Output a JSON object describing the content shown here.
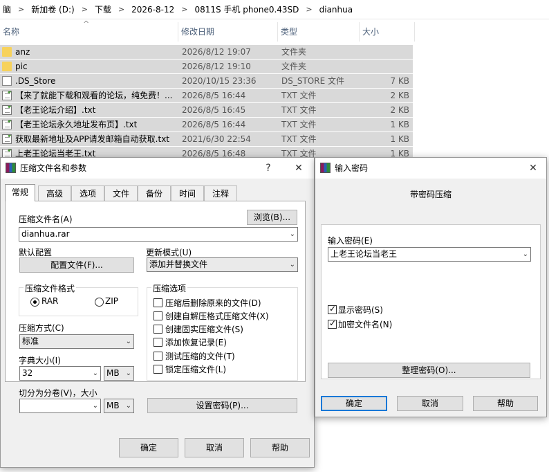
{
  "breadcrumb": [
    "脑",
    "新加卷 (D:)",
    "下载",
    "2026-8-12",
    "0811S 手机 phone0.43SD",
    "dianhua"
  ],
  "breadcrumb_sep": ">",
  "columns": {
    "name": "名称",
    "date": "修改日期",
    "type": "类型",
    "size": "大小"
  },
  "files": [
    {
      "icon": "folder-icon",
      "name": "anz",
      "date": "2026/8/12 19:07",
      "type": "文件夹",
      "size": ""
    },
    {
      "icon": "folder-icon",
      "name": "pic",
      "date": "2026/8/12 19:10",
      "type": "文件夹",
      "size": ""
    },
    {
      "icon": "file-icon",
      "name": ".DS_Store",
      "date": "2020/10/15 23:36",
      "type": "DS_STORE 文件",
      "size": "7 KB"
    },
    {
      "icon": "txt-icon",
      "name": "【来了就能下载和观看的论坛，纯免费！...",
      "date": "2026/8/5 16:44",
      "type": "TXT 文件",
      "size": "2 KB"
    },
    {
      "icon": "txt-icon",
      "name": "【老王论坛介绍】.txt",
      "date": "2026/8/5 16:45",
      "type": "TXT 文件",
      "size": "2 KB"
    },
    {
      "icon": "txt-icon",
      "name": "【老王论坛永久地址发布页】.txt",
      "date": "2026/8/5 16:44",
      "type": "TXT 文件",
      "size": "1 KB"
    },
    {
      "icon": "txt-icon",
      "name": "获取最新地址及APP请发邮箱自动获取.txt",
      "date": "2021/6/30 22:54",
      "type": "TXT 文件",
      "size": "1 KB"
    },
    {
      "icon": "txt-icon",
      "name": "上老王论坛当老王.txt",
      "date": "2026/8/5 16:48",
      "type": "TXT 文件",
      "size": "1 KB"
    }
  ],
  "archive_dialog": {
    "title": "压缩文件名和参数",
    "help_glyph": "?",
    "close_glyph": "✕",
    "tabs": [
      "常规",
      "高级",
      "选项",
      "文件",
      "备份",
      "时间",
      "注释"
    ],
    "archive_name_label": "压缩文件名(A)",
    "archive_name_value": "dianhua.rar",
    "browse_label": "浏览(B)...",
    "default_profile_label": "默认配置",
    "profile_button": "配置文件(F)...",
    "update_mode_label": "更新模式(U)",
    "update_mode_value": "添加并替换文件",
    "format_group": "压缩文件格式",
    "format_rar": "RAR",
    "format_zip": "ZIP",
    "options_group": "压缩选项",
    "options": [
      "压缩后删除原来的文件(D)",
      "创建自解压格式压缩文件(X)",
      "创建固实压缩文件(S)",
      "添加恢复记录(E)",
      "测试压缩的文件(T)",
      "锁定压缩文件(L)"
    ],
    "method_label": "压缩方式(C)",
    "method_value": "标准",
    "dict_label": "字典大小(I)",
    "dict_value": "32",
    "dict_unit": "MB",
    "split_label": "切分为分卷(V)，大小",
    "split_value": "",
    "split_unit": "MB",
    "set_password_button": "设置密码(P)...",
    "ok": "确定",
    "cancel": "取消",
    "help": "帮助"
  },
  "password_dialog": {
    "title": "输入密码",
    "close_glyph": "✕",
    "heading": "带密码压缩",
    "password_label": "输入密码(E)",
    "password_value": "上老王论坛当老王",
    "show_password": "显示密码(S)",
    "encrypt_names": "加密文件名(N)",
    "organize_button": "整理密码(O)...",
    "ok": "确定",
    "cancel": "取消",
    "help": "帮助"
  },
  "chevron": "⌄",
  "sort_glyph": "^"
}
